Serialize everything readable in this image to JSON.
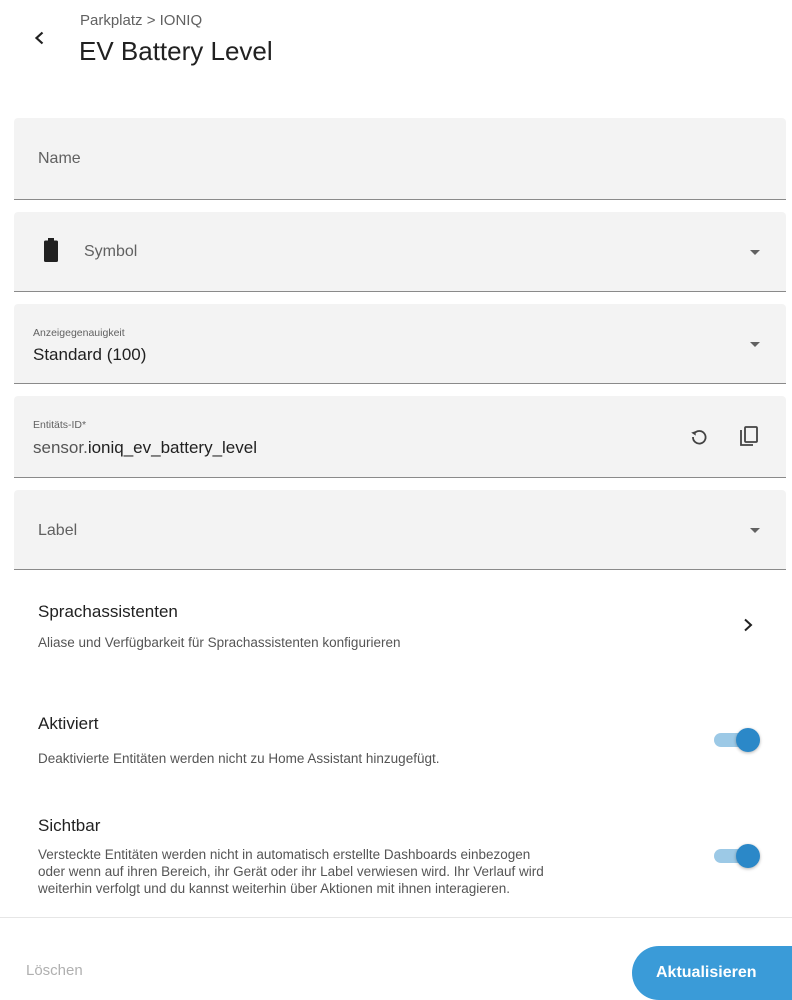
{
  "header": {
    "breadcrumb": "Parkplatz > IONIQ",
    "title": "EV Battery Level"
  },
  "form": {
    "name": {
      "placeholder": "Name"
    },
    "symbol": {
      "placeholder": "Symbol",
      "icon": "battery-icon"
    },
    "precision": {
      "label": "Anzeigegenauigkeit",
      "value": "Standard (100)"
    },
    "entity_id": {
      "label": "Entitäts-ID*",
      "prefix": "sensor.",
      "value": "ioniq_ev_battery_level"
    },
    "label": {
      "placeholder": "Label"
    }
  },
  "voice": {
    "title": "Sprachassistenten",
    "description": "Aliase und Verfügbarkeit für Sprachassistenten konfigurieren"
  },
  "enabled": {
    "title": "Aktiviert",
    "description": "Deaktivierte Entitäten werden nicht zu Home Assistant hinzugefügt.",
    "on": true
  },
  "visible": {
    "title": "Sichtbar",
    "description_lines": [
      "Versteckte Entitäten werden nicht in automatisch erstellte Dashboards einbezogen",
      "oder wenn auf ihren Bereich, ihr Gerät oder ihr Label verwiesen wird. Ihr Verlauf wird",
      "weiterhin verfolgt und du kannst weiterhin über Aktionen mit ihnen interagieren."
    ],
    "on": true
  },
  "footer": {
    "delete_label": "Löschen",
    "update_label": "Aktualisieren"
  },
  "colors": {
    "accent": "#3a9bd8",
    "toggle_track": "#9cc9e6",
    "toggle_knob": "#2b88c8",
    "field_bg": "#f3f3f3"
  }
}
